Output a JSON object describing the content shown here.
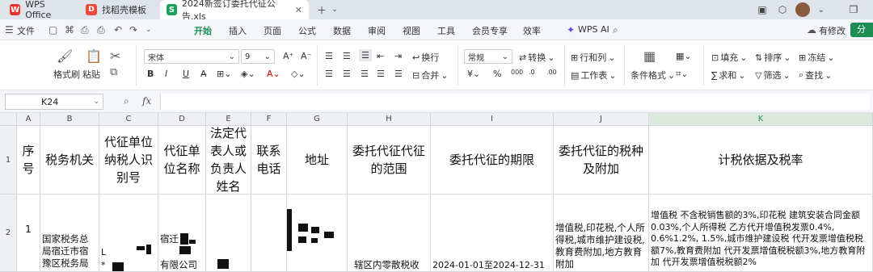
{
  "tabs": [
    {
      "label": "WPS Office",
      "icon": "wps-logo-icon"
    },
    {
      "label": "找稻壳模板",
      "icon": "docer-logo-icon"
    },
    {
      "label": "2024新签订委托代征公告.xls",
      "icon": "spreadsheet-icon"
    }
  ],
  "menu": {
    "file": "文件",
    "items": [
      "开始",
      "插入",
      "页面",
      "公式",
      "数据",
      "审阅",
      "视图",
      "工具",
      "会员专享",
      "效率"
    ],
    "active": "开始",
    "wps_ai": "WPS AI",
    "modified": "有修改",
    "share": "分"
  },
  "ribbon": {
    "format_painter": "格式刷",
    "paste": "粘贴",
    "font_name": "宋体",
    "font_size": "9",
    "wrap": "换行",
    "merge": "合并",
    "number_format": "常规",
    "convert": "转换",
    "rows_cols": "行和列",
    "worksheet": "工作表",
    "cond_format": "条件格式",
    "fill": "填充",
    "sort": "排序",
    "freeze": "冻结",
    "sum": "求和",
    "filter": "筛选",
    "find": "查找"
  },
  "formula_bar": {
    "name_box": "K24",
    "fx": "fx",
    "value": ""
  },
  "columns": [
    "A",
    "B",
    "C",
    "D",
    "E",
    "F",
    "G",
    "H",
    "I",
    "J",
    "K"
  ],
  "selected_column": "K",
  "rows": [
    "1",
    "2"
  ],
  "header_row": [
    "序号",
    "税务机关",
    "代征单位纳税人识别号",
    "代征单位名称",
    "法定代表人或负责人姓名",
    "联系电话",
    "地址",
    "委托代征代征的范围",
    "委托代征的期限",
    "委托代征的税种及附加",
    "计税依据及税率"
  ],
  "data_row": {
    "seq": "1",
    "tax_office": "国家税务总局宿迁市宿豫区税务局",
    "taxpayer_id_partial": "L",
    "company_partial_1": "宿迁",
    "company_partial_2": "有限公司",
    "scope": "辖区内零散税收",
    "period": "2024-01-01至2024-12-31",
    "tax_types": "增值税,印花税,个人所得税,城市维护建设税,教育费附加,地方教育附加",
    "tax_basis": "增值税 不含税销售额的3%,印花税 建筑安装合同金额0.03%,个人所得税 乙方代开增值税发票0.4%, 0.6%1.2%, 1.5%,城市维护建设税 代开发票增值税税额7%,教育费附加 代开发票增值税税额3%,地方教育附加 代开发票增值税税额2%"
  }
}
